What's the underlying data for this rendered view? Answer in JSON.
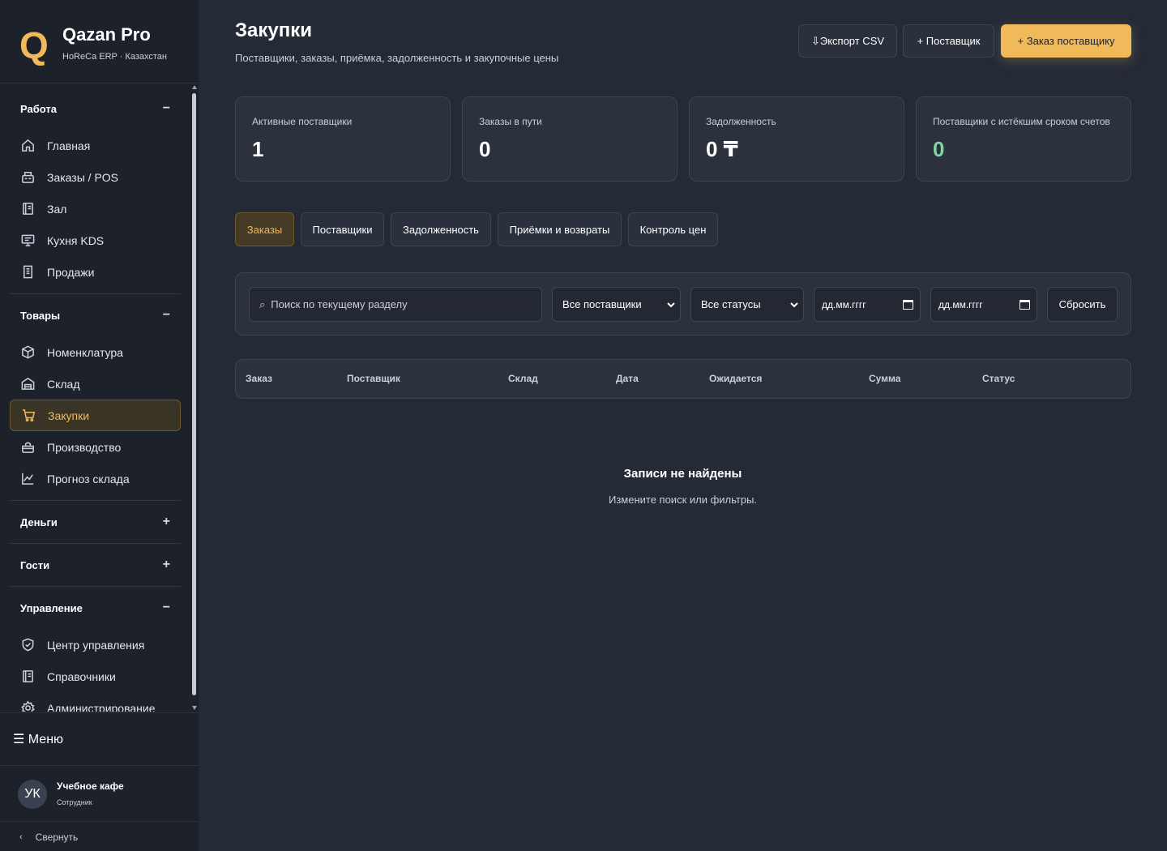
{
  "brand": {
    "logo": "Q",
    "name": "Qazan Pro",
    "subtitle": "HoReCa ERP · Казахстан"
  },
  "sidebar": {
    "groups": [
      {
        "label": "Работа",
        "toggle": "−",
        "items": [
          {
            "label": "Главная",
            "icon": "home-icon"
          },
          {
            "label": "Заказы / POS",
            "icon": "pos-icon"
          },
          {
            "label": "Зал",
            "icon": "hall-icon"
          },
          {
            "label": "Кухня KDS",
            "icon": "kds-icon"
          },
          {
            "label": "Продажи",
            "icon": "receipt-icon"
          }
        ]
      },
      {
        "label": "Товары",
        "toggle": "−",
        "items": [
          {
            "label": "Номенклатура",
            "icon": "box-icon"
          },
          {
            "label": "Склад",
            "icon": "warehouse-icon"
          },
          {
            "label": "Закупки",
            "icon": "cart-icon",
            "active": true
          },
          {
            "label": "Производство",
            "icon": "pot-icon"
          },
          {
            "label": "Прогноз склада",
            "icon": "chart-icon"
          }
        ]
      },
      {
        "label": "Деньги",
        "toggle": "+"
      },
      {
        "label": "Гости",
        "toggle": "+"
      },
      {
        "label": "Управление",
        "toggle": "−",
        "items": [
          {
            "label": "Центр управления",
            "icon": "shield-icon"
          },
          {
            "label": "Справочники",
            "icon": "book-icon"
          },
          {
            "label": "Администрирование",
            "icon": "gear-icon"
          }
        ]
      }
    ],
    "menu_label": "☰ Меню",
    "user": {
      "initials": "УК",
      "name": "Учебное кафе",
      "role": "Сотрудник"
    },
    "collapse_label": "Свернуть",
    "collapse_icon": "‹"
  },
  "header": {
    "title": "Закупки",
    "subtitle": "Поставщики, заказы, приёмка, задолженность и закупочные цены",
    "buttons": {
      "export": "⇩Экспорт CSV",
      "supplier": "+ Поставщик",
      "order": "+ Заказ поставщику"
    }
  },
  "stats": [
    {
      "label": "Активные поставщики",
      "value": "1"
    },
    {
      "label": "Заказы в пути",
      "value": "0"
    },
    {
      "label": "Задолженность",
      "value": "0 ₸"
    },
    {
      "label": "Поставщики с истёкшим сроком счетов",
      "value": "0"
    }
  ],
  "tabs": [
    "Заказы",
    "Поставщики",
    "Задолженность",
    "Приёмки и возвраты",
    "Контроль цен"
  ],
  "filters": {
    "search_icon": "⌕",
    "search_placeholder": "Поиск по текущему разделу",
    "supplier": "Все поставщики",
    "status": "Все статусы",
    "date_from": "дд.мм.гггг",
    "date_to": "дд.мм.гггг",
    "reset": "Сбросить"
  },
  "table": {
    "columns": [
      "Заказ",
      "Поставщик",
      "Склад",
      "Дата",
      "Ожидается",
      "Сумма",
      "Статус"
    ]
  },
  "empty": {
    "title": "Записи не найдены",
    "subtitle": "Измените поиск или фильтры."
  },
  "colors": {
    "accent": "#f0b95a",
    "background": "#252b36",
    "sidebar": "#1c212a",
    "positive": "#7fd4a0"
  }
}
